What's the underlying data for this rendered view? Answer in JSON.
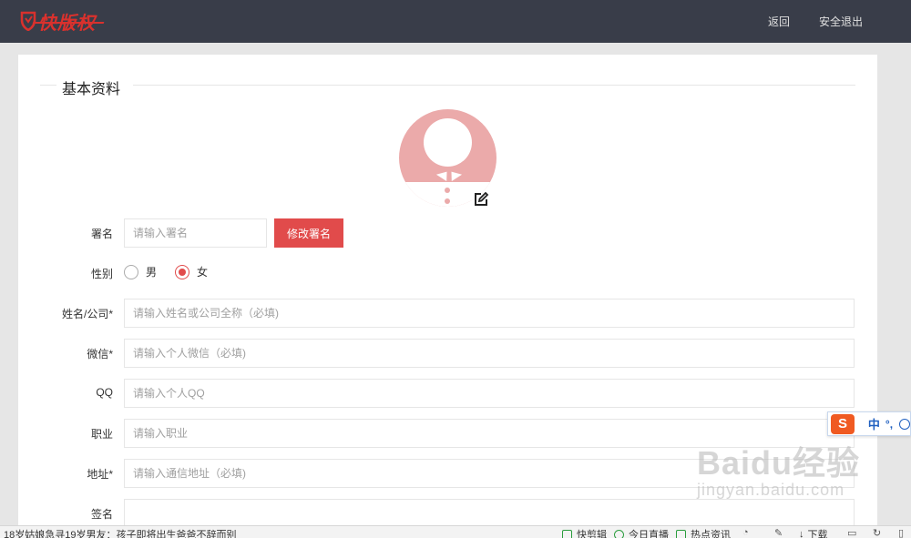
{
  "header": {
    "logo_text": "快版权",
    "nav": {
      "back_label": "返回",
      "logout_label": "安全退出"
    }
  },
  "section": {
    "title": "基本资料"
  },
  "form": {
    "signature": {
      "label": "署名",
      "placeholder": "请输入署名",
      "button_label": "修改署名"
    },
    "gender": {
      "label": "性别",
      "options": [
        "男",
        "女"
      ],
      "selected": "女"
    },
    "name_company": {
      "label": "姓名/公司*",
      "placeholder": "请输入姓名或公司全称（必填)"
    },
    "wechat": {
      "label": "微信*",
      "placeholder": "请输入个人微信（必填)"
    },
    "qq": {
      "label": "QQ",
      "placeholder": "请输入个人QQ"
    },
    "occupation": {
      "label": "职业",
      "placeholder": "请输入职业"
    },
    "address": {
      "label": "地址*",
      "placeholder": "请输入通信地址（必填)"
    },
    "bio": {
      "label": "签名"
    }
  },
  "colors": {
    "topbar": "#393d49",
    "brand_red": "#e14b4b",
    "avatar_pink": "#ebaaaa"
  },
  "ime": {
    "logo": "S",
    "mode": "中",
    "punct": "°,"
  },
  "watermark": {
    "main": "Baidu经验",
    "sub": "jingyan.baidu.com"
  },
  "statusbar": {
    "news": "18岁姑娘急寻19岁男友：孩子即将出生爸爸不辞而别",
    "items": [
      "快剪辑",
      "今日直播",
      "热点资讯",
      "下载"
    ]
  }
}
